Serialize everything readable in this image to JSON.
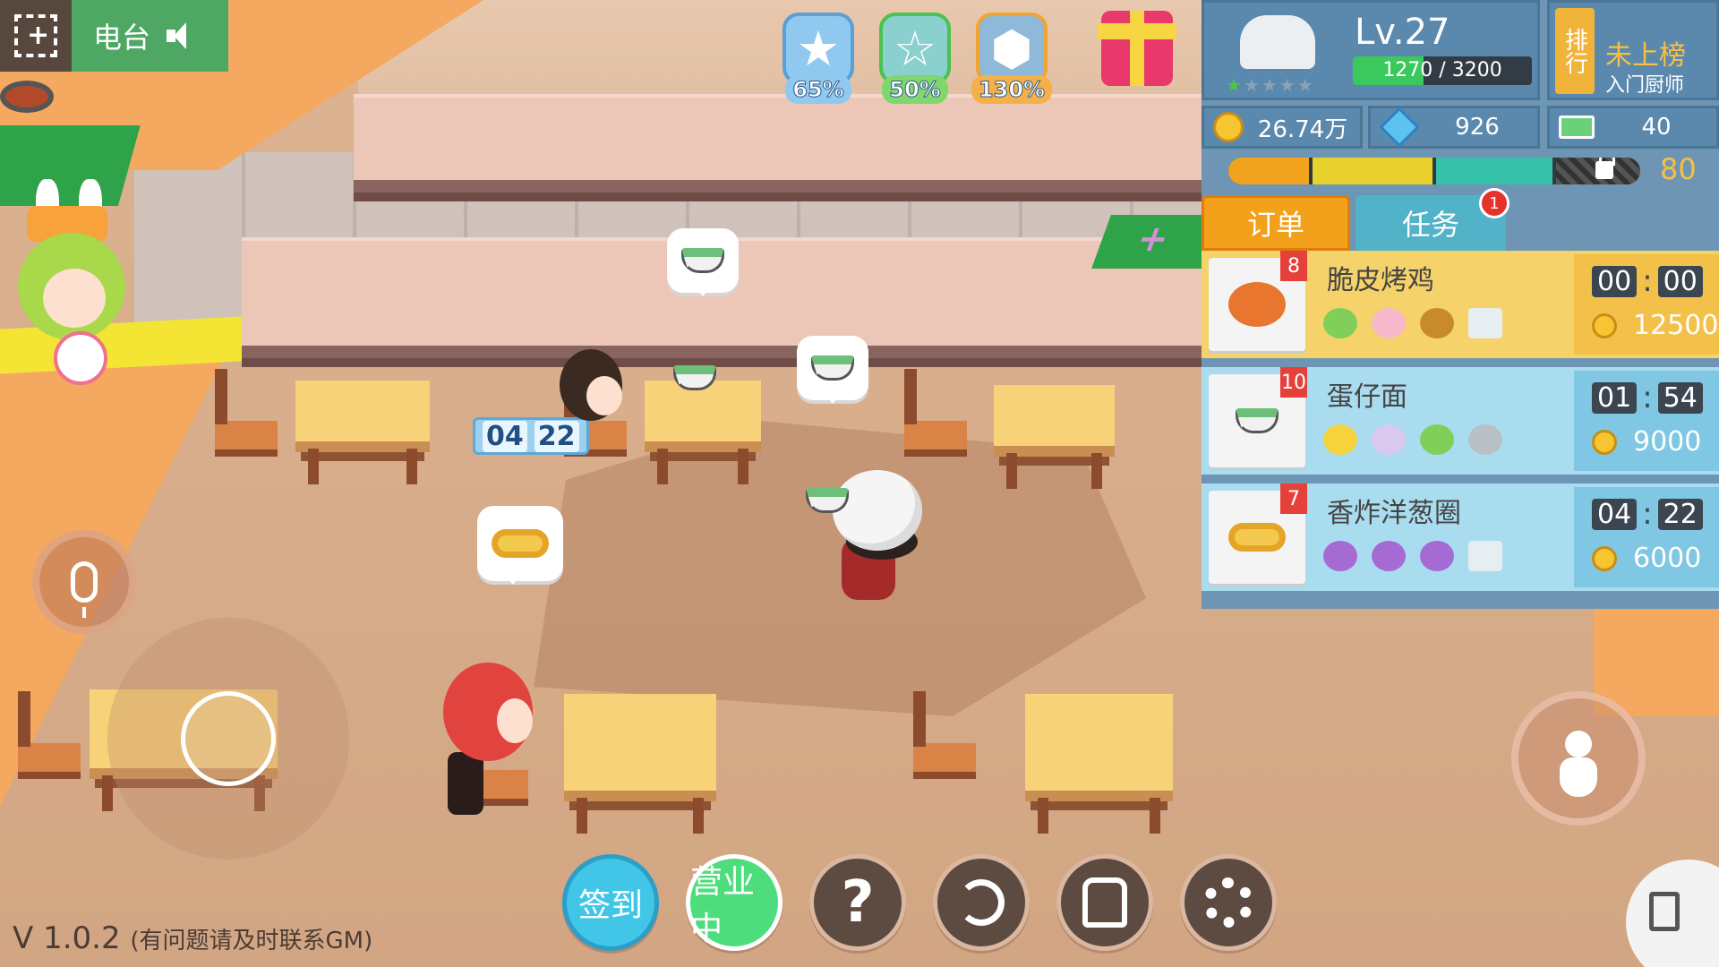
{
  "hud": {
    "radio_label": "电台",
    "ratings": [
      {
        "pct": "65%",
        "icon": "star-icon"
      },
      {
        "pct": "50%",
        "icon": "star-outline-icon"
      },
      {
        "pct": "130%",
        "icon": "chef-badge-icon"
      }
    ]
  },
  "profile": {
    "level": "Lv.27",
    "xp_text": "1270 / 3200",
    "xp_progress": 0.397,
    "stars_filled": 1,
    "stars_total": 5
  },
  "rank": {
    "tag": "排行",
    "status": "未上榜",
    "title": "入门厨师"
  },
  "currency": {
    "coins": "26.74万",
    "gems": "926",
    "cash": "40"
  },
  "energy": {
    "value": "80"
  },
  "tabs": {
    "orders": "订单",
    "tasks": "任务",
    "tasks_badge": "1"
  },
  "orders": [
    {
      "name": "脆皮烤鸡",
      "count": "8",
      "minutes": "00",
      "seconds": "00",
      "reward": "12500"
    },
    {
      "name": "蛋仔面",
      "count": "10",
      "minutes": "01",
      "seconds": "54",
      "reward": "9000"
    },
    {
      "name": "香炸洋葱圈",
      "count": "7",
      "minutes": "04",
      "seconds": "22",
      "reward": "6000"
    }
  ],
  "customer_timer": {
    "minutes": "04",
    "seconds": "22"
  },
  "bottom_bar": {
    "checkin": "签到",
    "open": "营业中"
  },
  "version": {
    "text": "V 1.0.2",
    "note": "(有问题请及时联系GM)"
  }
}
